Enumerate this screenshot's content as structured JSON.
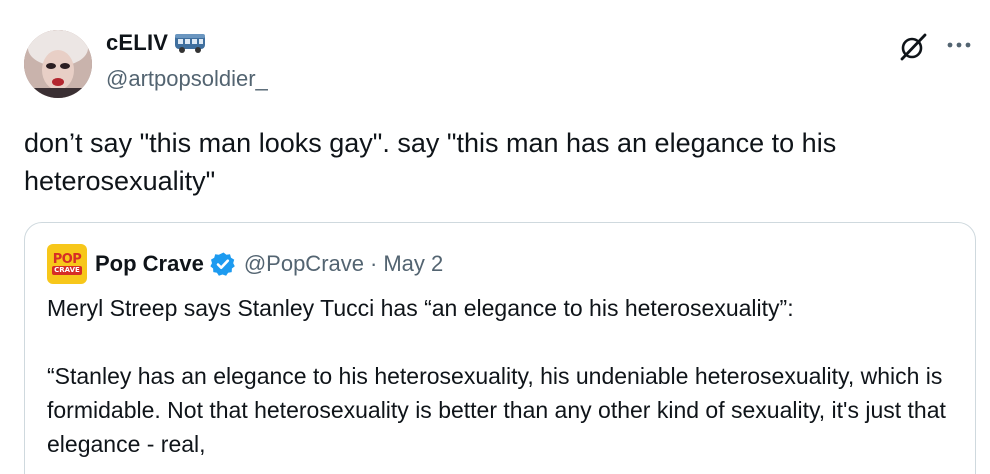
{
  "tweet": {
    "author": {
      "display_name": "cELIV",
      "emoji_icon": "bus-icon",
      "handle": "@artpopsoldier_"
    },
    "actions": {
      "grok_icon": "grok-icon",
      "more_icon": "more-icon"
    },
    "text": "don’t say \"this man looks gay\". say \"this man has an elegance to his heterosexuality\""
  },
  "quote": {
    "author": {
      "avatar_line1": "POP",
      "avatar_line2": "CRAVE",
      "display_name": "Pop Crave",
      "verified_icon": "verified-badge-icon",
      "handle": "@PopCrave",
      "separator": "·",
      "date": "May 2"
    },
    "paragraph1": "Meryl Streep says Stanley Tucci has “an elegance to his heterosexuality”:",
    "paragraph2": "“Stanley has an elegance to his heterosexuality, his undeniable heterosexuality, which is formidable. Not that heterosexuality is better than any other kind of sexuality, it's just that elegance - real,"
  },
  "colors": {
    "text": "#0f1419",
    "secondary": "#536471",
    "border": "#cfd9de",
    "verified": "#1d9bf0",
    "pop_yellow": "#f7c71a",
    "pop_red": "#d62d26"
  }
}
